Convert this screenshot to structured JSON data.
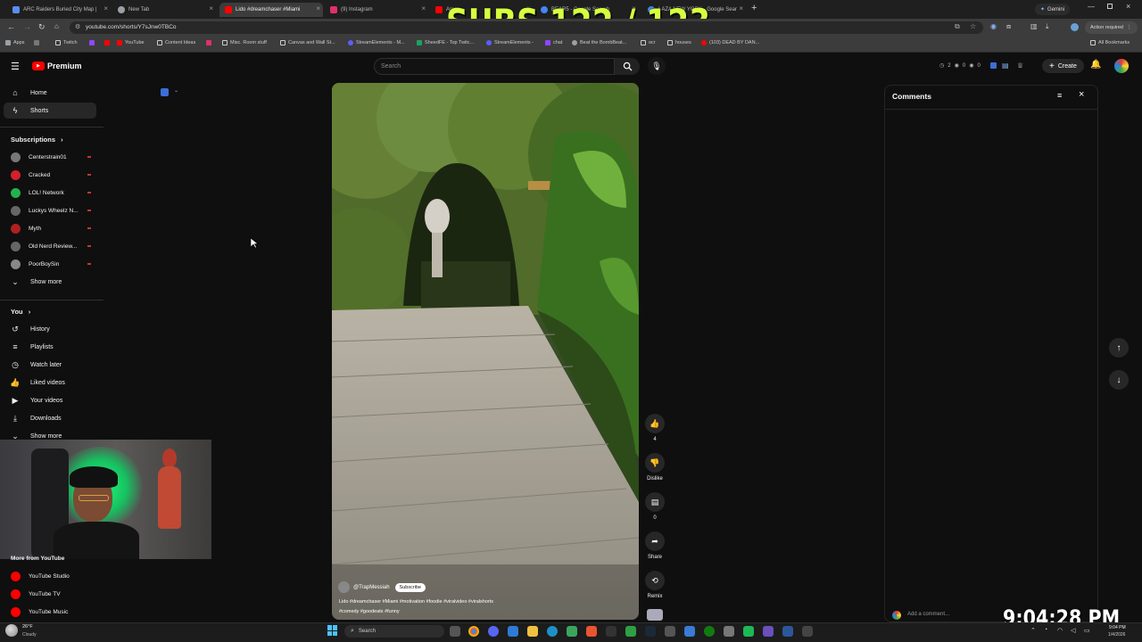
{
  "browser": {
    "tabs": [
      {
        "label": "ARC Raiders Buried City Map |",
        "color": "#5b8def"
      },
      {
        "label": "New Tab",
        "color": "#9aa0a6"
      },
      {
        "label": "Lido #dreamchaser #Miami",
        "color": "#ff0000"
      },
      {
        "label": "(9) Instagram",
        "color": "#e1306c"
      },
      {
        "label": "Amaz...",
        "color": "#ff0000"
      },
      {
        "label": "BEAR5 - Google Search",
        "color": "#4285f4"
      },
      {
        "label": "LAZA NEW YORK - Google Sear",
        "color": "#4285f4"
      }
    ],
    "url": "youtube.com/shorts/Y7sJnw0TBCo",
    "gemini_label": "Gemini",
    "action_required": "Action required",
    "bookmarks": [
      {
        "label": "Apps",
        "color": "#9aa0a6"
      },
      {
        "label": "Twitch",
        "color": "#9146ff"
      },
      {
        "label": "",
        "color": "#ff0000"
      },
      {
        "label": "YouTube",
        "color": "#ff0000"
      },
      {
        "label": "Content Ideas",
        "color": "#9aa0a6"
      },
      {
        "label": "",
        "color": "#e1306c"
      },
      {
        "label": "Misc. Room stuff",
        "color": "#9aa0a6"
      },
      {
        "label": "Canvas and Wall St...",
        "color": "#9aa0a6"
      },
      {
        "label": "StreamElements - M...",
        "color": "#5d5dff"
      },
      {
        "label": "SheedFE - Top Twitc...",
        "color": "#1aa260"
      },
      {
        "label": "StreamElements -",
        "color": "#5d5dff"
      },
      {
        "label": "chat",
        "color": "#9146ff"
      },
      {
        "label": "Beat the BombBeat...",
        "color": "#9aa0a6"
      },
      {
        "label": "ocr",
        "color": "#9aa0a6"
      },
      {
        "label": "houses",
        "color": "#9aa0a6"
      },
      {
        "label": "(103) DEAD BY DAN...",
        "color": "#ff0000"
      }
    ],
    "all_bookmarks": "All Bookmarks"
  },
  "overlay": {
    "subs_text": "SUBS 122 / 123",
    "clock_text": "9:04:28 PM"
  },
  "youtube": {
    "logo_text": "Premium",
    "search_placeholder": "Search",
    "create_label": "Create",
    "counters": [
      "2",
      "0",
      "0"
    ],
    "sidebar": {
      "main": [
        {
          "label": "Home",
          "icon": "home-icon"
        },
        {
          "label": "Shorts",
          "icon": "shorts-icon"
        }
      ],
      "subscriptions_title": "Subscriptions",
      "subscriptions": [
        {
          "label": "Centerstrain01",
          "color": "#777"
        },
        {
          "label": "Cracked",
          "color": "#d4202a"
        },
        {
          "label": "LOL! Network",
          "color": "#23b14d"
        },
        {
          "label": "Luckys Wheelz N...",
          "color": "#666"
        },
        {
          "label": "Myth",
          "color": "#b02020"
        },
        {
          "label": "Old Nerd Review...",
          "color": "#666"
        },
        {
          "label": "PoorBoySin",
          "color": "#888"
        }
      ],
      "show_more": "Show more",
      "you_title": "You",
      "you_items": [
        {
          "label": "History",
          "icon": "history-icon"
        },
        {
          "label": "Playlists",
          "icon": "playlists-icon"
        },
        {
          "label": "Watch later",
          "icon": "watch-later-icon"
        },
        {
          "label": "Liked videos",
          "icon": "liked-icon"
        },
        {
          "label": "Your videos",
          "icon": "your-videos-icon"
        },
        {
          "label": "Downloads",
          "icon": "downloads-icon"
        }
      ],
      "show_more_2": "Show more",
      "more_title": "More from YouTube",
      "more_items": [
        {
          "label": "YouTube Studio"
        },
        {
          "label": "YouTube TV"
        },
        {
          "label": "YouTube Music"
        }
      ]
    },
    "short": {
      "channel": "@TrapMessiah",
      "subscribe": "Subscribe",
      "caption_line1": "Lido #dreamchaser #Miami #motivation #foodie #viralvideo #viralshorts",
      "caption_line2": "#comedy #goodeats #funny",
      "likes": "4",
      "dislike": "Dislike",
      "comments": "0",
      "share": "Share",
      "remix": "Remix"
    },
    "comments_panel": {
      "title": "Comments",
      "add_placeholder": "Add a comment..."
    }
  },
  "taskbar": {
    "weather_temp": "26°F",
    "weather_desc": "Cloudy",
    "search": "Search",
    "time": "9:04 PM",
    "date": "1/4/2026"
  }
}
